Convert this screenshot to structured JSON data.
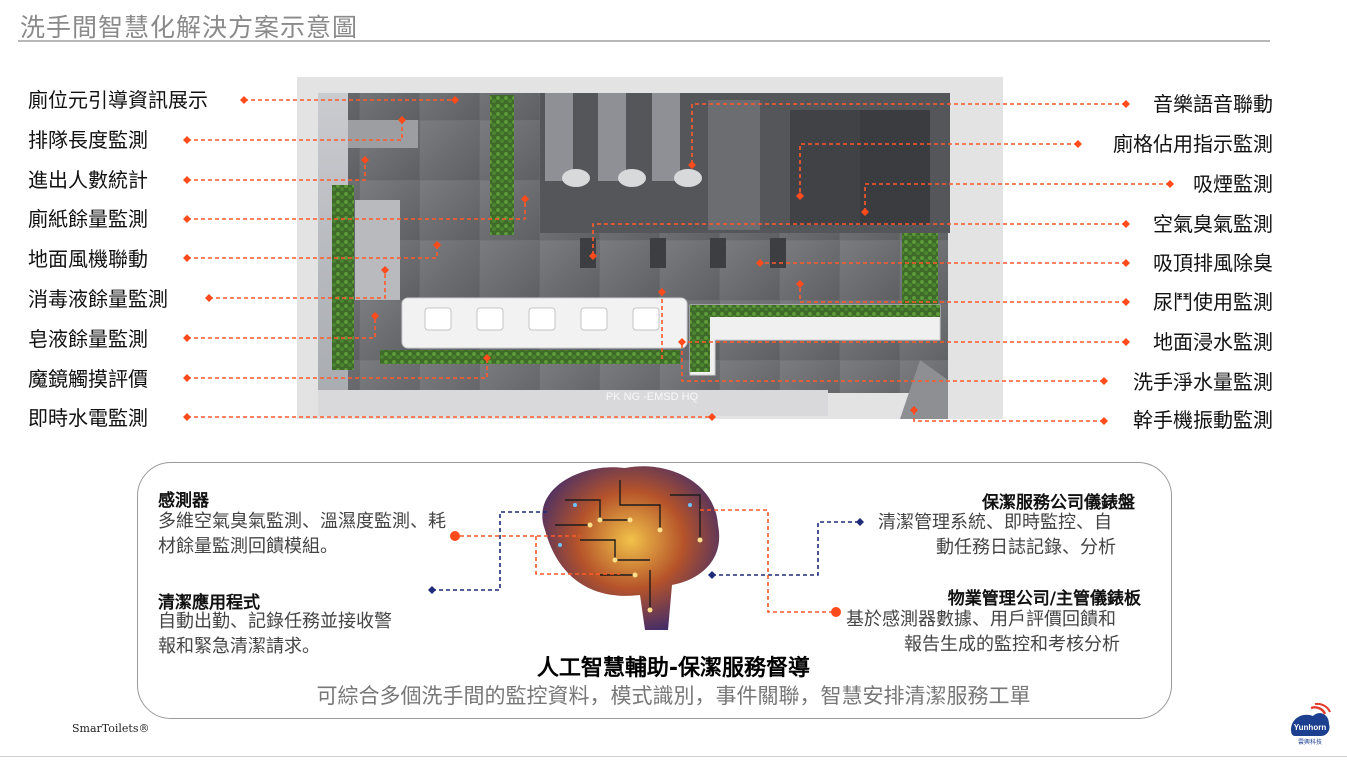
{
  "page_title": "洗手間智慧化解決方案示意圖",
  "left_labels": [
    "廁位元引導資訊展示",
    "排隊長度監測",
    "進出人數統計",
    "廁紙餘量監測",
    "地面風機聯動",
    "消毒液餘量監測",
    "皂液餘量監測",
    "魔鏡觸摸評價",
    "即時水電監測"
  ],
  "right_labels": [
    "音樂語音聯動",
    "廁格佔用指示監測",
    "吸煙監測",
    "空氣臭氣監測",
    "吸頂排風除臭",
    "尿鬥使用監測",
    "地面浸水監測",
    "洗手淨水量監測",
    "幹手機振動監測"
  ],
  "floorplan_watermark": "PK NG -EMSD HQ",
  "blocks": {
    "sensor": {
      "title": "感測器",
      "lines": [
        "多維空氣臭氣監測、溫濕度監測、耗",
        "材餘量監測回饋模組。"
      ]
    },
    "app": {
      "title": "清潔應用程式",
      "lines": [
        "自動出勤、記錄任務並接收警",
        "報和緊急清潔請求。"
      ]
    },
    "cleaning_dashboard": {
      "title": "保潔服務公司儀錶盤",
      "lines": [
        "清潔管理系統、即時監控、自",
        "動任務日誌記錄、分析"
      ]
    },
    "property_dashboard": {
      "title": "物業管理公司/主管儀錶板",
      "lines": [
        "基於感測器數據、用戶評價回饋和",
        "報告生成的監控和考核分析"
      ]
    }
  },
  "ai_heading": "人工智慧輔助-保潔服務督導",
  "ai_subheading": "可綜合多個洗手間的監控資料，模式識別，事件關聯，智慧安排清潔服務工單",
  "footer_brand": "SmarToilets®",
  "logo_text": "Yunhorn",
  "logo_subtext": "雲興科技",
  "colors": {
    "accent": "#ff4a1c",
    "navy": "#1d2b7a",
    "dash": "#ff5a2a"
  }
}
